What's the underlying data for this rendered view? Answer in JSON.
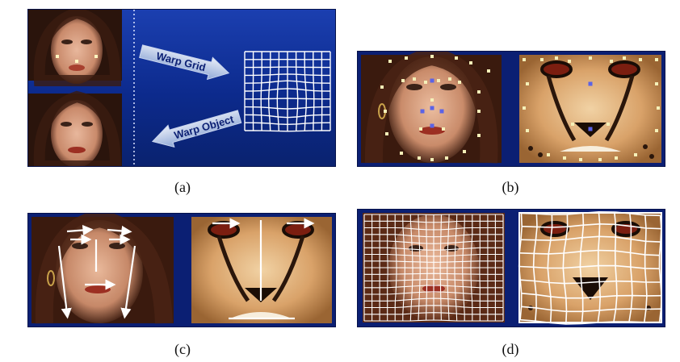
{
  "captions": {
    "a": "(a)",
    "b": "(b)",
    "c": "(c)",
    "d": "(d)"
  },
  "panel_a": {
    "arrow_top": "Warp Grid",
    "arrow_bottom": "Warp Object"
  }
}
